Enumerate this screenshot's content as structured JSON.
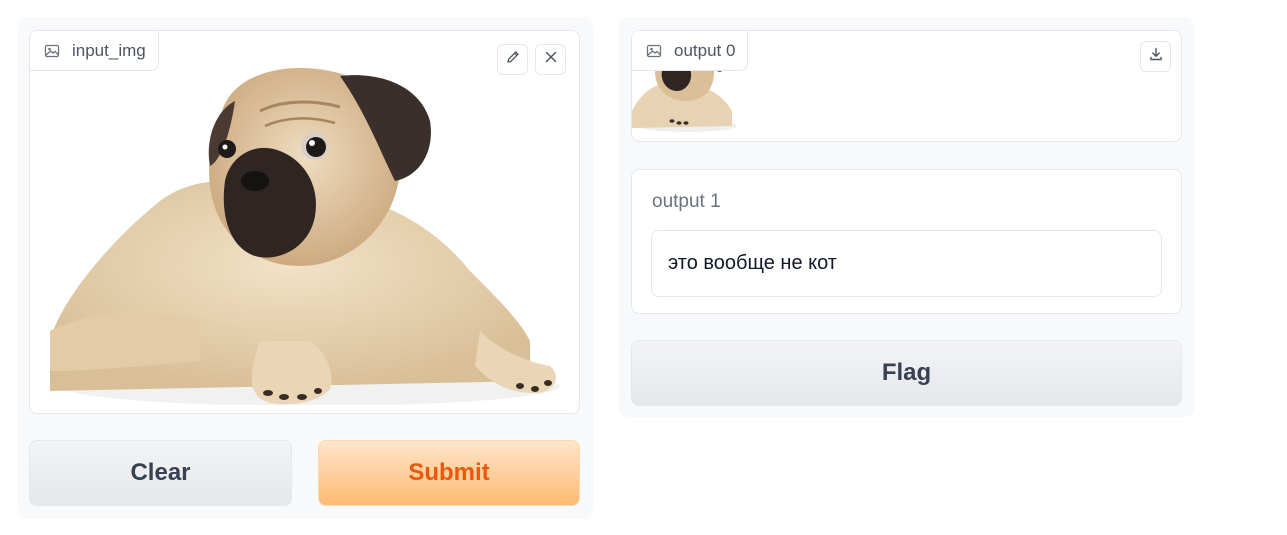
{
  "input": {
    "label": "input_img",
    "image_icon": "image-icon",
    "edit_icon": "pencil-icon",
    "clear_icon": "close-icon",
    "image_subject": "pug puppy lying down on white background"
  },
  "actions": {
    "clear_label": "Clear",
    "submit_label": "Submit",
    "flag_label": "Flag"
  },
  "output0": {
    "label": "output 0",
    "image_icon": "image-icon",
    "download_icon": "download-icon"
  },
  "output1": {
    "label": "output 1",
    "value": "это вообще не кот"
  },
  "colors": {
    "accent": "#ea580c",
    "accent_bg": "#fdba74",
    "panel_bg": "#f8f9fb",
    "border": "#e5e7eb"
  }
}
